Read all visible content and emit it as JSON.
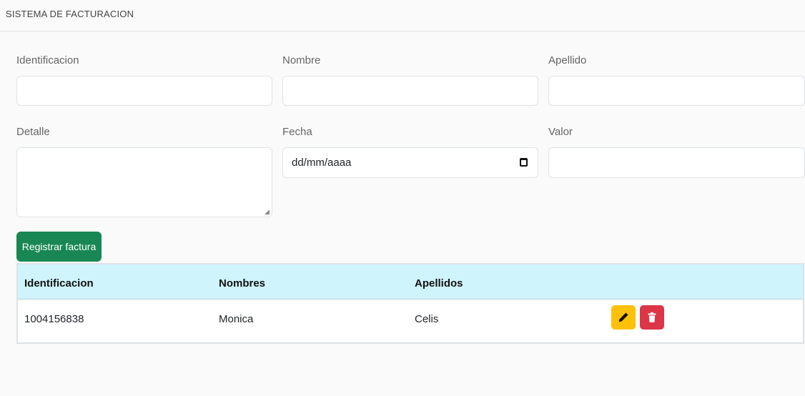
{
  "header": {
    "title": "SISTEMA DE FACTURACION"
  },
  "form": {
    "identificacion": {
      "label": "Identificacion",
      "value": ""
    },
    "nombre": {
      "label": "Nombre",
      "value": ""
    },
    "apellido": {
      "label": "Apellido",
      "value": ""
    },
    "detalle": {
      "label": "Detalle",
      "value": ""
    },
    "fecha": {
      "label": "Fecha",
      "placeholder": "dd/mm/aaaa"
    },
    "valor": {
      "label": "Valor",
      "value": ""
    },
    "submit_label": "Registrar factura"
  },
  "table": {
    "columns": [
      "Identificacion",
      "Nombres",
      "Apellidos"
    ],
    "rows": [
      {
        "identificacion": "1004156838",
        "nombres": "Monica",
        "apellidos": "Celis"
      }
    ]
  },
  "colors": {
    "register_button": "#198754",
    "edit_button": "#ffc107",
    "delete_button": "#dc3545",
    "table_header": "#cff4fc"
  },
  "icons": {
    "edit": "pencil-icon",
    "delete": "trash-icon",
    "date": "calendar-icon"
  }
}
